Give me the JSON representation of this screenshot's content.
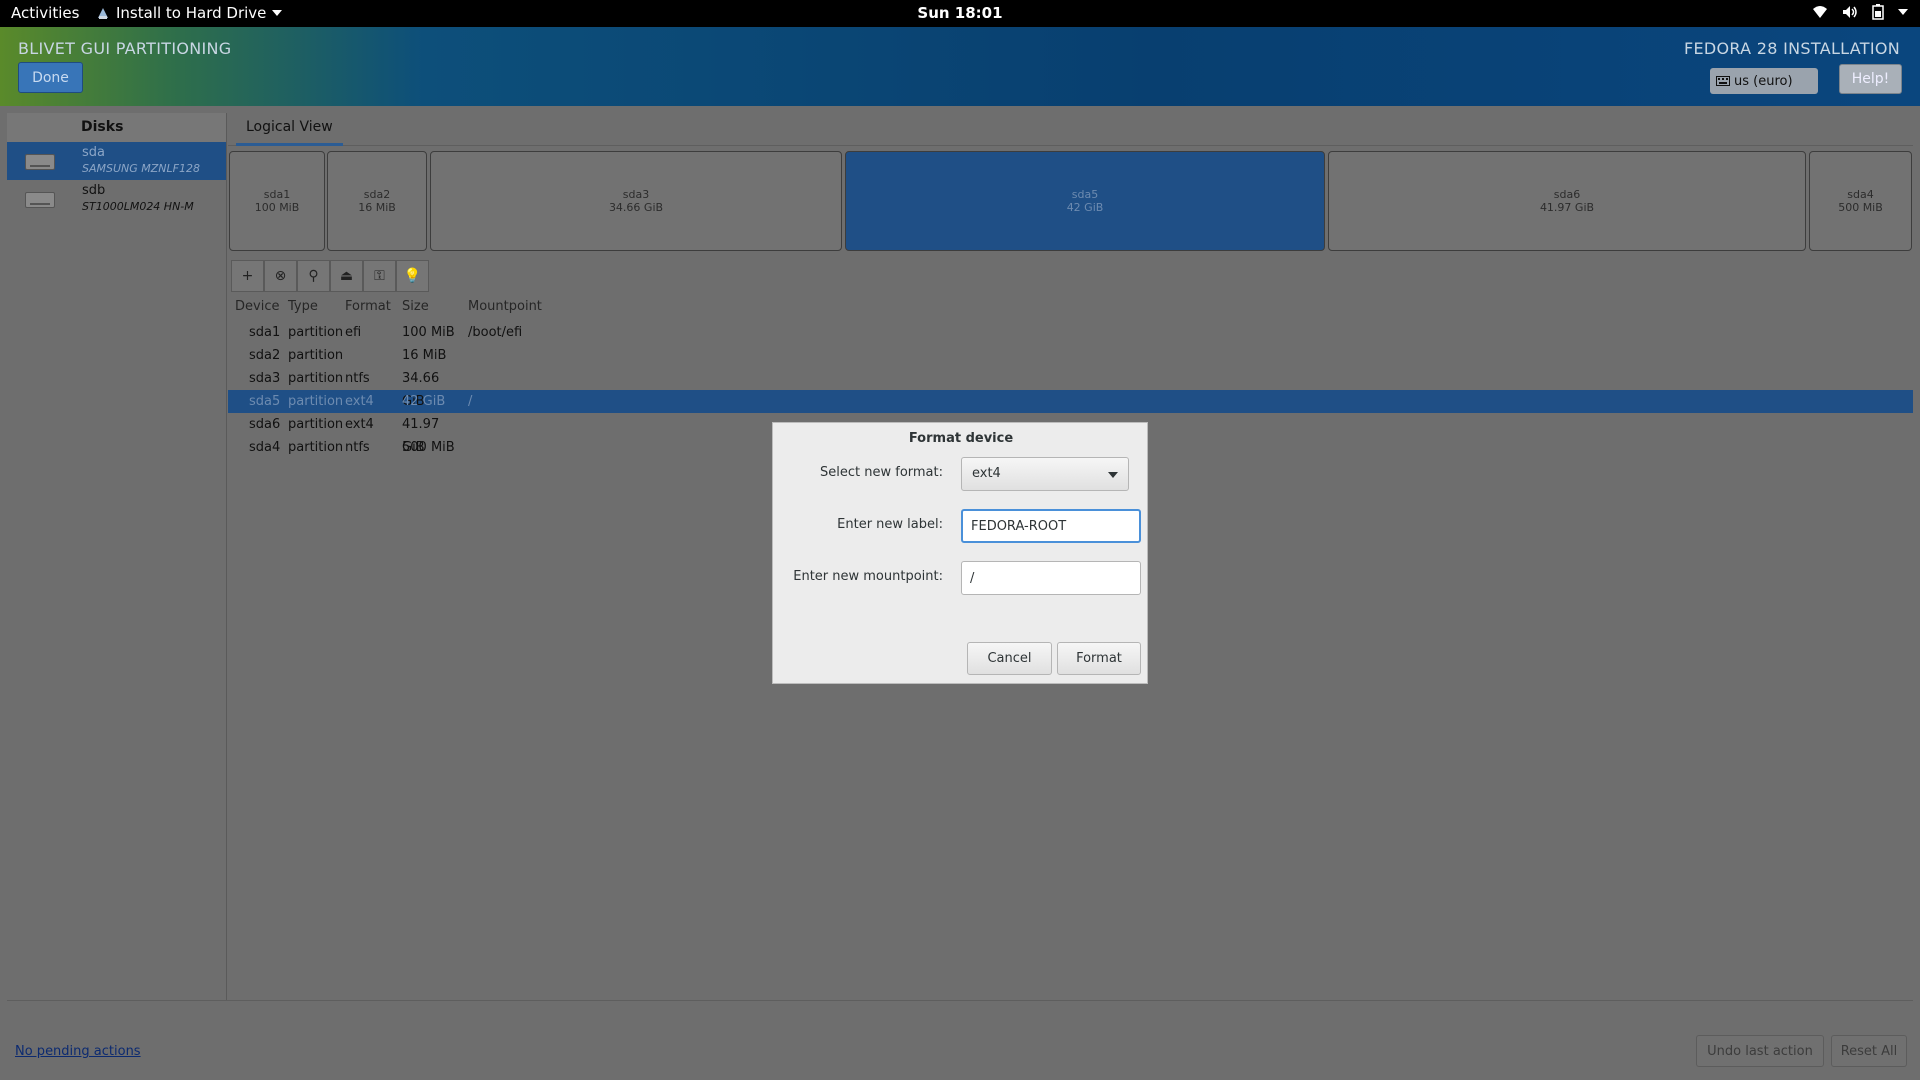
{
  "topbar": {
    "activities": "Activities",
    "app_menu": "Install to Hard Drive",
    "clock": "Sun 18:01",
    "tray_icons": [
      "wifi-icon",
      "volume-icon",
      "battery-icon",
      "system-menu-icon"
    ]
  },
  "header": {
    "title_left": "BLIVET GUI PARTITIONING",
    "title_right": "FEDORA 28 INSTALLATION",
    "done_label": "Done",
    "keyboard_layout": "us (euro)",
    "help_label": "Help!"
  },
  "sidebar": {
    "heading": "Disks",
    "disks": [
      {
        "name": "sda",
        "model": "SAMSUNG MZNLF128",
        "selected": true
      },
      {
        "name": "sdb",
        "model": "ST1000LM024 HN-M",
        "selected": false
      }
    ]
  },
  "tabs": [
    {
      "label": "Logical View"
    }
  ],
  "partition_bar": [
    {
      "name": "sda1",
      "size": "100 MiB"
    },
    {
      "name": "sda2",
      "size": "16 MiB"
    },
    {
      "name": "sda3",
      "size": "34.66 GiB"
    },
    {
      "name": "sda5",
      "size": "42 GiB",
      "selected": true
    },
    {
      "name": "sda6",
      "size": "41.97 GiB"
    },
    {
      "name": "sda4",
      "size": "500 MiB"
    }
  ],
  "toolbar": {
    "add": "+",
    "delete": "⊗",
    "edit": "⚲",
    "unmount": "⏏",
    "decrypt": "⚿",
    "info": "💡"
  },
  "table": {
    "columns": [
      "Device",
      "Type",
      "Format",
      "Size",
      "Mountpoint"
    ],
    "rows": [
      [
        "sda1",
        "partition",
        "efi",
        "100 MiB",
        "/boot/efi"
      ],
      [
        "sda2",
        "partition",
        "",
        "16 MiB",
        ""
      ],
      [
        "sda3",
        "partition",
        "ntfs",
        "34.66 GiB",
        ""
      ],
      [
        "sda5",
        "partition",
        "ext4",
        "42 GiB",
        "/"
      ],
      [
        "sda6",
        "partition",
        "ext4",
        "41.97 GiB",
        ""
      ],
      [
        "sda4",
        "partition",
        "ntfs",
        "500 MiB",
        ""
      ]
    ],
    "selected_row": 3
  },
  "statusbar": {
    "pending": "No pending actions",
    "undo_label": "Undo last action",
    "reset_label": "Reset All"
  },
  "dialog": {
    "title": "Format device",
    "format_label": "Select new format:",
    "format_value": "ext4",
    "label_label": "Enter new label:",
    "label_value": "FEDORA-ROOT",
    "mount_label": "Enter new mountpoint:",
    "mount_value": "/",
    "cancel_label": "Cancel",
    "format_button": "Format"
  }
}
